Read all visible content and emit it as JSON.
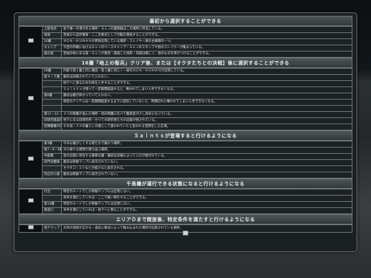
{
  "sections": [
    {
      "title": "最初から選択することができる",
      "rows": [
        {
          "name": "上陸地点",
          "desc": "島で唯一の港がある場所・ＧｏＪの艦隊群はこの場所に停泊している。"
        },
        {
          "name": "領海",
          "desc": "至福から自然豊富・ここを拠点として行動を開始することができる。"
        },
        {
          "name": "16層",
          "desc": "ＮＯＮ－ＨＵＭＡＮが原則出現している場所・スレイヤー達の主戦場の一つ。"
        },
        {
          "name": "キャンプ",
          "desc": "今回の作戦におけるＧｏＪのベースキャンプ・ＧｏＪのスタッフや他のスレイヤーが集まっている。"
        },
        {
          "name": "森の奥",
          "desc": "至福の地にある森・ＧｏＪが発見・調査した地形・深部は険しく、他のものを寄せつけることができる。"
        }
      ]
    },
    {
      "title": "16層「地上の衛兵」クリア後、または【オクタたちとの決戦】後に選択することができる",
      "rows": [
        {
          "name": "18層",
          "desc": "内部で第１層と同じ構造・第１層と同じく一部のＮＯＮ－ＨＵＭＡＮが出現している。"
        },
        {
          "name": "第４・５層",
          "desc": "最初は封鎖されていて入れない。"
        },
        {
          "name": "",
          "desc": "地下へと潜るための扉を入手することができる。"
        },
        {
          "name": "",
          "desc": "Ｓａｉｎｔｓが潜って一定期間経過すると、奪われてしまい入手できなくなる。"
        },
        {
          "name": "第6層",
          "desc": "最初は鍵が掛かっていて入れない。"
        },
        {
          "name": "",
          "desc": "特定のアイテムは一定期間経過するまでに回収していないと、時間切れに奪われてしまい入手できなくなる。"
        },
        {
          "name": "",
          "desc": ""
        },
        {
          "name": "第11・12・13層",
          "desc": "３つの階層が並んだ場所・他の階層に比べて難易度が少し高めになっている。"
        },
        {
          "name": "旧研究施設地",
          "desc": "地下にある旧研究所・かつての研究者たちの記録が残されている。"
        },
        {
          "name": "近隣警備の場",
          "desc": "その他・人々の暮らしの場として使われていたと思われる空間をした広場。"
        }
      ]
    },
    {
      "title": "Ｓａｉｎｔｓが登場すると行けるようになる",
      "rows": [
        {
          "name": "第3層",
          "desc": "今日も騒がしくする者たちで賑わう場所。"
        },
        {
          "name": "第7・8・9層",
          "desc": "大小様々な建物が建ち並ぶ場所。"
        },
        {
          "name": "中部層",
          "desc": "島の北側に存在する重要な層・最初は封鎖によって入口が塞がれている。"
        },
        {
          "name": "旧門前都跡",
          "desc": "最初は移動マップに表示されていない。"
        },
        {
          "name": "",
          "desc": "オクタコ・ミソなどが抜けると表示される。"
        },
        {
          "name": "浜辺の小屋",
          "desc": "最初は移動マップに表示されていない。"
        }
      ]
    },
    {
      "title": "千鳥機が運行できる状態になると行けるようになる",
      "rows": [
        {
          "name": "灯台",
          "desc": "特定のルートでしか移動マップには出現しない。"
        },
        {
          "name": "",
          "desc": "条件を満たしていれば・ここで買い物をすることができる。"
        },
        {
          "name": "第14層",
          "desc": "特定のルートでしか移動マップには出現しない。"
        },
        {
          "name": "鉄道口",
          "desc": "条件を満たしていれば・地下へと潜ることができる。"
        }
      ]
    },
    {
      "title": "エリアＤまで開放後、特定条件を満たすと行けるようになる",
      "rows": [
        {
          "name": "地下マップ",
          "desc": "天然の洞窟が広がる・過去に数名によって踏み込まれた場所が記録されている場所。"
        }
      ]
    }
  ],
  "icon": "broken-image-icon"
}
